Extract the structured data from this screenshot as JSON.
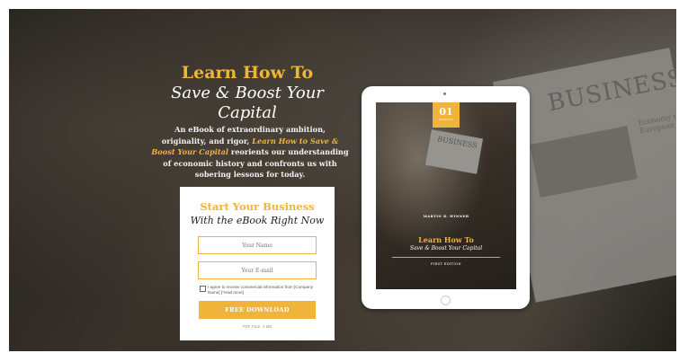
{
  "hero": {
    "title": "Learn How To",
    "subtitle": "Save & Boost Your Capital",
    "body_before": "An eBook of extraordinary ambition, originality, and rigor, ",
    "body_accent": "Learn How to Save & Boost Your Capital",
    "body_after": " reorients our understanding of economic history and confronts us with sobering lessons for today."
  },
  "form": {
    "title": "Start Your Business",
    "subtitle": "With the eBook Right Now",
    "name_placeholder": "Your Name",
    "email_placeholder": "Your E-mail",
    "consent": "I agree to receive commercial information from [Company Name] [*read more]",
    "button": "FREE DOWNLOAD",
    "file_info": "PDF FILE, 3 MB"
  },
  "tablet": {
    "badge_number": "01",
    "badge_label": "EDITION",
    "newspaper_label": "BUSINESS",
    "author": "MARTIN R. WINNER",
    "title": "Learn How To",
    "subtitle": "Save & Boost Your Capital",
    "edition": "FIRST EDITION"
  },
  "background": {
    "newspaper_headline": "BUSINESS",
    "newspaper_small": "Economy of European U"
  },
  "colors": {
    "accent": "#f0b43a",
    "text_light": "#ffffff",
    "text_dark": "#222222"
  }
}
